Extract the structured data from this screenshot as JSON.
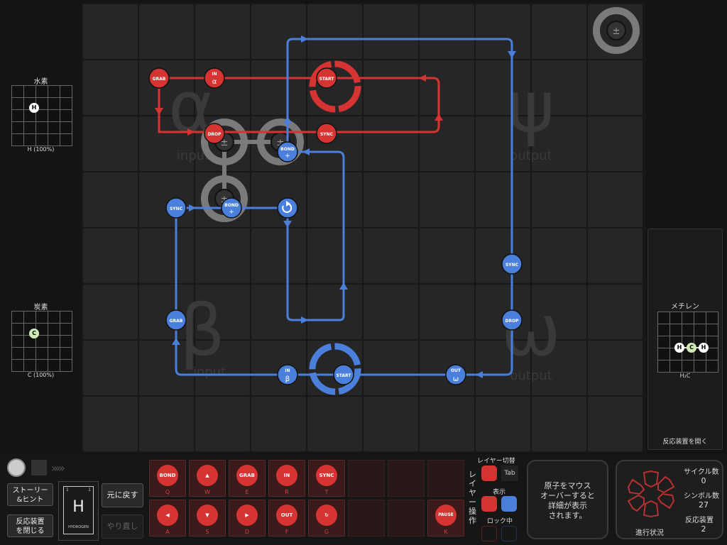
{
  "reactor": {
    "zones": {
      "alpha_glyph": "α",
      "alpha_label": "input",
      "beta_glyph": "β",
      "beta_label": "input",
      "psi_glyph": "ψ",
      "psi_label": "output",
      "omega_glyph": "ω",
      "omega_label": "output"
    },
    "bonder_symbol": "±",
    "colors": {
      "red_waldo": "#d63333",
      "blue_waldo": "#4a7fdb",
      "bonder": "#7a7a7a",
      "cell": "#262626"
    },
    "red_instructions": {
      "grab": "GRAB",
      "in": "IN",
      "in_sub": "α",
      "start": "START",
      "drop": "DROP",
      "sync": "SYNC"
    },
    "blue_instructions": {
      "bond_top": "BOND",
      "bond_top_sub": "+",
      "sync_left": "SYNC",
      "bond_mid": "BOND",
      "bond_mid_sub": "+",
      "sync_right": "SYNC",
      "grab": "GRAB",
      "drop": "DROP",
      "in": "IN",
      "in_sub": "β",
      "start": "START",
      "out": "OUT",
      "out_sub": "ω"
    }
  },
  "left_panel": {
    "hydrogen_title": "水素",
    "hydrogen_atom": "H",
    "hydrogen_caption": "H (100%)",
    "carbon_title": "炭素",
    "carbon_atom": "C",
    "carbon_caption": "C (100%)"
  },
  "right_panel": {
    "title": "メチレン",
    "atoms": [
      "H",
      "C",
      "H"
    ],
    "formula": "H₂C",
    "open_button": "反応装置を開く"
  },
  "bottom": {
    "story_button": "ストーリー\n&ヒント",
    "close_button": "反応装置\nを閉じる",
    "element_symbol": "H",
    "element_number": "1",
    "element_weight": "1",
    "element_name": "HYDROGEN",
    "undo_button": "元に戻す",
    "redo_button": "やり直し",
    "tools_top": [
      {
        "name": "BOND",
        "sub": "+",
        "key": "Q"
      },
      {
        "name": "▲",
        "sub": "",
        "key": "W"
      },
      {
        "name": "GRAB",
        "sub": "DROP",
        "key": "E"
      },
      {
        "name": "IN",
        "sub": "α",
        "key": "R"
      },
      {
        "name": "SYNC",
        "sub": "",
        "key": "T"
      }
    ],
    "tools_bottom": [
      {
        "name": "◀",
        "sub": "",
        "key": "A"
      },
      {
        "name": "▼",
        "sub": "",
        "key": "S"
      },
      {
        "name": "▶",
        "sub": "",
        "key": "D"
      },
      {
        "name": "OUT",
        "sub": "ψ",
        "key": "F"
      },
      {
        "name": "↻",
        "sub": "",
        "key": "G"
      }
    ],
    "pause_tool": {
      "name": "PAUSE",
      "key": "K"
    },
    "layer_switch_label": "レイヤー切替",
    "tab_key": "Tab",
    "layer_ops_label": "レイヤー操作",
    "show_label": "表示",
    "lock_label": "ロック中",
    "info_text": "原子をマウス\nオーバーすると\n詳細が表示\nされます。",
    "progress_label": "進行状況",
    "cycles_label": "サイクル数",
    "cycles_value": "0",
    "symbols_label": "シンボル数",
    "symbols_value": "27",
    "reactors_label": "反応装置",
    "reactors_value": "2"
  }
}
